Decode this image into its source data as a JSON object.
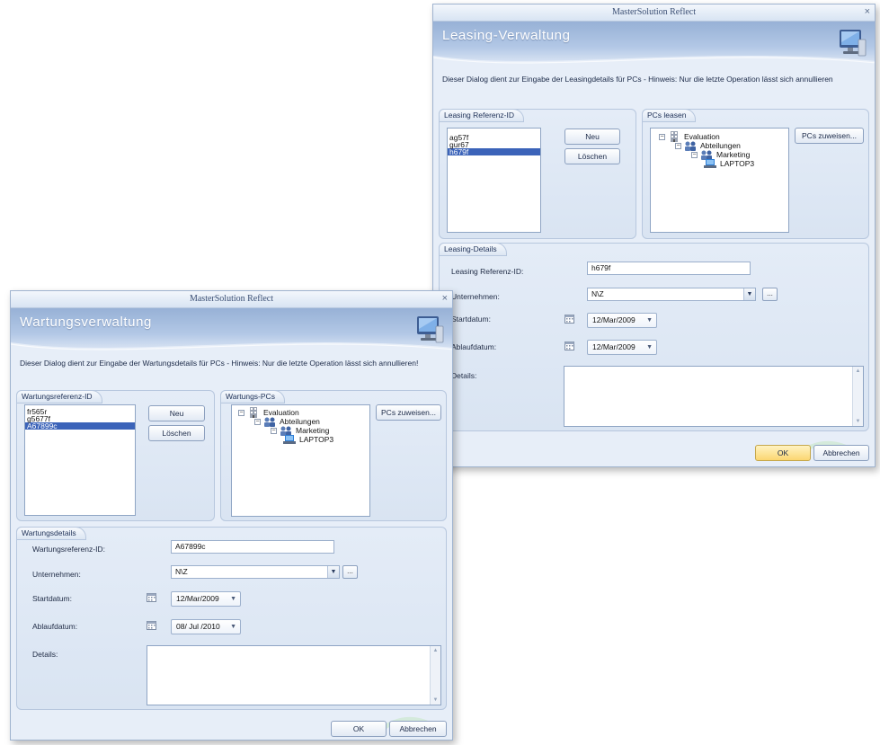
{
  "leasing_dialog": {
    "window_title": "MasterSolution Reflect",
    "close_glyph": "×",
    "banner_title": "Leasing-Verwaltung",
    "hint": "Dieser Dialog dient zur Eingabe der Leasingdetails für PCs - Hinweis: Nur die letzte Operation lässt sich annullieren",
    "id_group": {
      "title": "Leasing Referenz-ID",
      "items": [
        "ag57f",
        "gur67",
        "h679f"
      ],
      "selected_index": 2,
      "new_label": "Neu",
      "delete_label": "Löschen"
    },
    "pcs_group": {
      "title": "PCs leasen",
      "assign_label": "PCs zuweisen...",
      "tree": [
        "Evaluation",
        "Abteilungen",
        "Marketing",
        "LAPTOP3"
      ]
    },
    "details_group": {
      "title": "Leasing-Details",
      "ref_label": "Leasing Referenz-ID:",
      "ref_value": "h679f",
      "company_label": "Unternehmen:",
      "company_value": "N\\Z",
      "ellipsis": "...",
      "start_label": "Startdatum:",
      "start_value": "12/Mar/2009",
      "end_label": "Ablaufdatum:",
      "end_value": "12/Mar/2009",
      "details_label": "Details:"
    },
    "ok_label": "OK",
    "cancel_label": "Abbrechen"
  },
  "maintenance_dialog": {
    "window_title": "MasterSolution Reflect",
    "close_glyph": "×",
    "banner_title": "Wartungsverwaltung",
    "hint": "Dieser Dialog dient zur Eingabe der Wartungsdetails für PCs - Hinweis: Nur die letzte Operation lässt sich annullieren!",
    "id_group": {
      "title": "Wartungsreferenz-ID",
      "items": [
        "fr565r",
        "g5677f",
        "A67899c"
      ],
      "selected_index": 2,
      "new_label": "Neu",
      "delete_label": "Löschen"
    },
    "pcs_group": {
      "title": "Wartungs-PCs",
      "assign_label": "PCs zuweisen...",
      "tree": [
        "Evaluation",
        "Abteilungen",
        "Marketing",
        "LAPTOP3"
      ]
    },
    "details_group": {
      "title": "Wartungsdetails",
      "ref_label": "Wartungsreferenz-ID:",
      "ref_value": "A67899c",
      "company_label": "Unternehmen:",
      "company_value": "N\\Z",
      "ellipsis": "...",
      "start_label": "Startdatum:",
      "start_value": "12/Mar/2009",
      "end_label": "Ablaufdatum:",
      "end_value": "08/ Jul /2010",
      "details_label": "Details:"
    },
    "ok_label": "OK",
    "cancel_label": "Abbrechen"
  },
  "icons": {
    "banner": "computer-monitor-icon",
    "tree": [
      "building-icon",
      "group-icon",
      "group-icon",
      "laptop-icon"
    ],
    "date": "calendar-icon",
    "dropdown": "chevron-down-icon"
  },
  "colors": {
    "selection": "#3b63b9",
    "banner_top": "#97b1d6",
    "window_bg": "#e7eef8",
    "ok_highlight": "#fbd671"
  }
}
